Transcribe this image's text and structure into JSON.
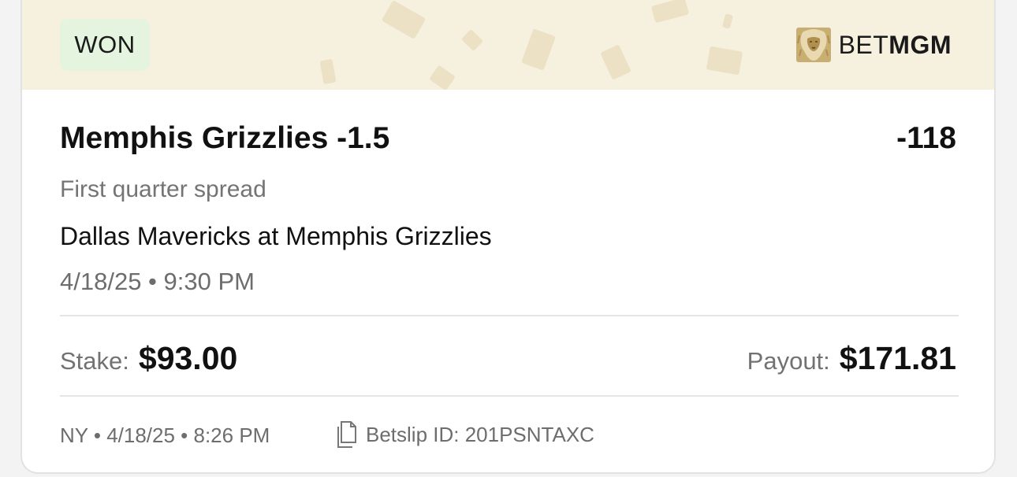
{
  "status_badge": "WON",
  "brand": {
    "icon": "lion-logo-icon",
    "name_light": "BET",
    "name_bold": "MGM"
  },
  "bet": {
    "selection": "Memphis Grizzlies -1.5",
    "odds": "-118",
    "market": "First quarter spread",
    "event": "Dallas Mavericks at Memphis Grizzlies",
    "event_time": "4/18/25 • 9:30 PM"
  },
  "amounts": {
    "stake_label": "Stake:",
    "stake_value": "$93.00",
    "payout_label": "Payout:",
    "payout_value": "$171.81"
  },
  "footer": {
    "placed_info": "NY • 4/18/25 • 8:26 PM",
    "copy_icon": "copy-document-icon",
    "betslip_id": "Betslip ID: 201PSNTAXC"
  },
  "colors": {
    "header_bg": "#f6f0df",
    "badge_bg": "#e4f4df",
    "logo_gold": "#b89a5a"
  }
}
